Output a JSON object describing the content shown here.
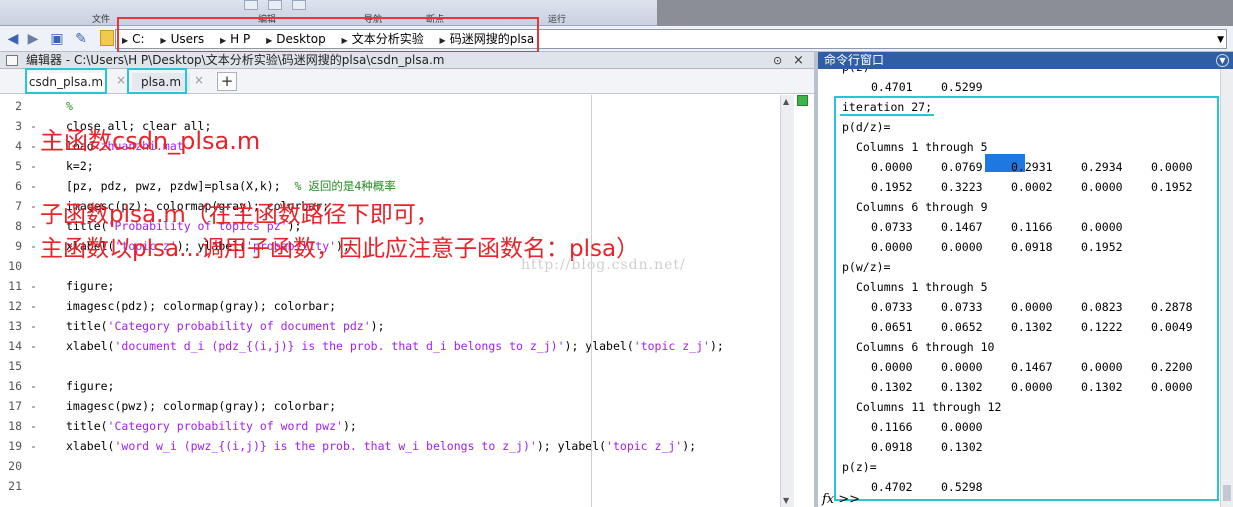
{
  "ribbon": {
    "sections": [
      "文件",
      "编辑",
      "导航",
      "断点",
      "运行"
    ]
  },
  "address_bar": {
    "segments": [
      "C:",
      "Users",
      "H P",
      "Desktop",
      "文本分析实验",
      "码迷网搜的plsa"
    ]
  },
  "editor": {
    "title": "编辑器 - C:\\Users\\H P\\Desktop\\文本分析实验\\码迷网搜的plsa\\csdn_plsa.m",
    "tabs": [
      {
        "label": "csdn_plsa.m"
      },
      {
        "label": "plsa.m"
      }
    ],
    "add_tab": "+",
    "close_label": "×",
    "lines": [
      {
        "num": "2",
        "dash": "",
        "parts": [
          {
            "t": "%",
            "k": "c"
          }
        ]
      },
      {
        "num": "3",
        "dash": "-",
        "parts": [
          {
            "t": "close all; clear all;",
            "k": ""
          }
        ]
      },
      {
        "num": "4",
        "dash": "-",
        "parts": [
          {
            "t": "load ",
            "k": ""
          },
          {
            "t": "zhuanzhi.mat",
            "k": "s"
          }
        ]
      },
      {
        "num": "5",
        "dash": "-",
        "parts": [
          {
            "t": "k=2;",
            "k": ""
          }
        ]
      },
      {
        "num": "6",
        "dash": "-",
        "parts": [
          {
            "t": "[pz, pdz, pwz, pzdw]=plsa(X,k);  ",
            "k": ""
          },
          {
            "t": "% 返回的是4种概率",
            "k": "c"
          }
        ]
      },
      {
        "num": "7",
        "dash": "-",
        "parts": [
          {
            "t": "imagesc(pz); colormap(gray); colorbar;",
            "k": ""
          }
        ]
      },
      {
        "num": "8",
        "dash": "-",
        "parts": [
          {
            "t": "title(",
            "k": ""
          },
          {
            "t": "'Probability of topics pz'",
            "k": "s"
          },
          {
            "t": ");",
            "k": ""
          }
        ]
      },
      {
        "num": "9",
        "dash": "-",
        "parts": [
          {
            "t": "xlabel(",
            "k": ""
          },
          {
            "t": "'topic z'",
            "k": "s"
          },
          {
            "t": "); ylabel(",
            "k": ""
          },
          {
            "t": "'probability'",
            "k": "s"
          },
          {
            "t": ");",
            "k": ""
          }
        ]
      },
      {
        "num": "10",
        "dash": "",
        "parts": []
      },
      {
        "num": "11",
        "dash": "-",
        "parts": [
          {
            "t": "figure;",
            "k": ""
          }
        ]
      },
      {
        "num": "12",
        "dash": "-",
        "parts": [
          {
            "t": "imagesc(pdz); colormap(gray); colorbar;",
            "k": ""
          }
        ]
      },
      {
        "num": "13",
        "dash": "-",
        "parts": [
          {
            "t": "title(",
            "k": ""
          },
          {
            "t": "'Category probability of document pdz'",
            "k": "s"
          },
          {
            "t": ");",
            "k": ""
          }
        ]
      },
      {
        "num": "14",
        "dash": "-",
        "parts": [
          {
            "t": "xlabel(",
            "k": ""
          },
          {
            "t": "'document d_i (pdz_{(i,j)} is the prob. that d_i belongs to z_j)'",
            "k": "s"
          },
          {
            "t": "); ylabel(",
            "k": ""
          },
          {
            "t": "'topic z_j'",
            "k": "s"
          },
          {
            "t": ");",
            "k": ""
          }
        ]
      },
      {
        "num": "15",
        "dash": "",
        "parts": []
      },
      {
        "num": "16",
        "dash": "-",
        "parts": [
          {
            "t": "figure;",
            "k": ""
          }
        ]
      },
      {
        "num": "17",
        "dash": "-",
        "parts": [
          {
            "t": "imagesc(pwz); colormap(gray); colorbar;",
            "k": ""
          }
        ]
      },
      {
        "num": "18",
        "dash": "-",
        "parts": [
          {
            "t": "title(",
            "k": ""
          },
          {
            "t": "'Category probability of word pwz'",
            "k": "s"
          },
          {
            "t": ");",
            "k": ""
          }
        ]
      },
      {
        "num": "19",
        "dash": "-",
        "parts": [
          {
            "t": "xlabel(",
            "k": ""
          },
          {
            "t": "'word w_i (pwz_{(i,j)} is the prob. that w_i belongs to z_j)'",
            "k": "s"
          },
          {
            "t": "); ylabel(",
            "k": ""
          },
          {
            "t": "'topic z_j'",
            "k": "s"
          },
          {
            "t": ");",
            "k": ""
          }
        ]
      },
      {
        "num": "20",
        "dash": "",
        "parts": []
      },
      {
        "num": "21",
        "dash": "",
        "parts": []
      }
    ]
  },
  "annotations": {
    "main_label": "主函数csdn_plsa.m",
    "sub_label": "子函数plsa.m（在主函数路径下即可，",
    "sub_label_2": "主函数以plsa...调用子函数，因此应注意子函数名：plsa）",
    "watermark": "http://blog.csdn.net/"
  },
  "command_window": {
    "title": "命令行窗口",
    "rows": [
      {
        "type": "text",
        "text": "p(z)="
      },
      {
        "type": "values",
        "vals": [
          "0.4701",
          "0.5299"
        ]
      },
      {
        "type": "text",
        "text": "iteration 27;"
      },
      {
        "type": "text",
        "text": "p(d/z)="
      },
      {
        "type": "header",
        "text": "Columns 1 through 5"
      },
      {
        "type": "values",
        "vals": [
          "0.0000",
          "0.0769",
          "0.2931",
          "0.2934",
          "0.0000"
        ]
      },
      {
        "type": "values",
        "vals": [
          "0.1952",
          "0.3223",
          "0.0002",
          "0.0000",
          "0.1952"
        ]
      },
      {
        "type": "header",
        "text": "Columns 6 through 9"
      },
      {
        "type": "values",
        "vals": [
          "0.0733",
          "0.1467",
          "0.1166",
          "0.0000"
        ]
      },
      {
        "type": "values",
        "vals": [
          "0.0000",
          "0.0000",
          "0.0918",
          "0.1952"
        ]
      },
      {
        "type": "text",
        "text": "p(w/z)="
      },
      {
        "type": "header",
        "text": "Columns 1 through 5"
      },
      {
        "type": "values",
        "vals": [
          "0.0733",
          "0.0733",
          "0.0000",
          "0.0823",
          "0.2878"
        ]
      },
      {
        "type": "values",
        "vals": [
          "0.0651",
          "0.0652",
          "0.1302",
          "0.1222",
          "0.0049"
        ]
      },
      {
        "type": "header",
        "text": "Columns 6 through 10"
      },
      {
        "type": "values",
        "vals": [
          "0.0000",
          "0.0000",
          "0.1467",
          "0.0000",
          "0.2200"
        ]
      },
      {
        "type": "values",
        "vals": [
          "0.1302",
          "0.1302",
          "0.0000",
          "0.1302",
          "0.0000"
        ]
      },
      {
        "type": "header",
        "text": "Columns 11 through 12"
      },
      {
        "type": "values",
        "vals": [
          "0.1166",
          "0.0000"
        ]
      },
      {
        "type": "values",
        "vals": [
          "0.0918",
          "0.1302"
        ]
      },
      {
        "type": "text",
        "text": "p(z)="
      },
      {
        "type": "values",
        "vals": [
          "0.4702",
          "0.5298"
        ]
      }
    ],
    "prompt": "fx >>"
  }
}
